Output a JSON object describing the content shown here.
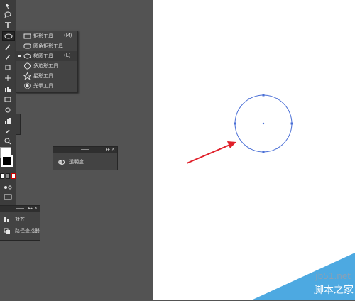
{
  "flyout": {
    "items": [
      {
        "label": "矩形工具",
        "shortcut": "(M)",
        "icon": "rectangle-tool-icon"
      },
      {
        "label": "圆角矩形工具",
        "shortcut": "",
        "icon": "rounded-rectangle-tool-icon"
      },
      {
        "label": "椭圆工具",
        "shortcut": "(L)",
        "icon": "ellipse-tool-icon",
        "selected": true
      },
      {
        "label": "多边形工具",
        "shortcut": "",
        "icon": "polygon-tool-icon"
      },
      {
        "label": "星形工具",
        "shortcut": "",
        "icon": "star-tool-icon"
      },
      {
        "label": "光晕工具",
        "shortcut": "",
        "icon": "flare-tool-icon"
      }
    ]
  },
  "transparency_panel": {
    "label": "透明度",
    "controls": "▸▸ ✕"
  },
  "align_panel": {
    "items": [
      {
        "label": "对齐"
      },
      {
        "label": "路径查找器"
      }
    ],
    "controls": "▸▸ ✕"
  },
  "canvas": {
    "shape": "circle",
    "stroke_color": "#4a6fd6",
    "arrow_color": "#e0202a"
  },
  "watermark": {
    "site": "jb51.net",
    "brand": "脚本之家"
  }
}
